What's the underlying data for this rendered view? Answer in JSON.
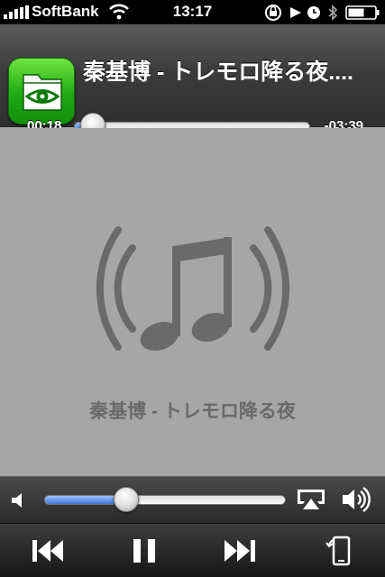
{
  "status_bar": {
    "carrier": "SoftBank",
    "time": "13:17",
    "icons": [
      "signal-icon",
      "wifi-icon",
      "orientation-lock-icon",
      "play-icon",
      "alarm-icon",
      "bluetooth-icon",
      "battery-icon"
    ]
  },
  "now_playing": {
    "title": "秦基博 - トレモロ降る夜....",
    "elapsed": "00:18",
    "remaining": "-03:39",
    "progress": 0.08,
    "artwork_title": "秦基博 - トレモロ降る夜"
  },
  "volume": {
    "level": 0.34
  },
  "controls": [
    "previous-track-icon",
    "pause-icon",
    "next-track-icon",
    "rotate-icon"
  ],
  "colors": {
    "accent": "#3d79d8",
    "background": "#a6a6a6",
    "art_glyph": "#6a6a6a",
    "app_icon": "#1fa815"
  }
}
